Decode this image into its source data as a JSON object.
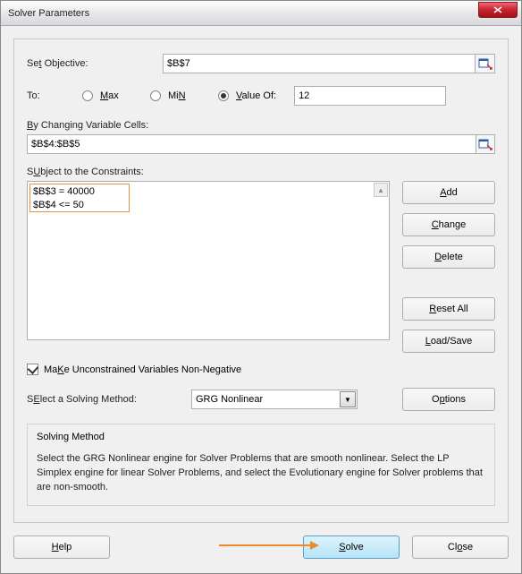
{
  "title": "Solver Parameters",
  "objective": {
    "label": "Set Objective:",
    "hotkey": "t",
    "value": "$B$7"
  },
  "to": {
    "label": "To:",
    "max": "Max",
    "max_hot": "M",
    "min": "Min",
    "min_hot": "N",
    "valueof": "Value Of:",
    "valueof_hot": "V",
    "value": "12"
  },
  "changing": {
    "label": "By Changing Variable Cells:",
    "hot": "B",
    "value": "$B$4:$B$5"
  },
  "constraints": {
    "label": "Subject to the Constraints:",
    "hot": "U",
    "items": [
      "$B$3 = 40000",
      "$B$4 <= 50"
    ]
  },
  "buttons": {
    "add": "Add",
    "add_hot": "A",
    "change": "Change",
    "change_hot": "C",
    "delete": "Delete",
    "delete_hot": "D",
    "reset": "Reset All",
    "reset_hot": "R",
    "loadsave": "Load/Save",
    "loadsave_hot": "L",
    "options": "Options",
    "options_hot": "p",
    "help": "Help",
    "help_hot": "H",
    "solve": "Solve",
    "solve_hot": "S",
    "close": "Close",
    "close_hot": "o"
  },
  "nonneg": {
    "label": "Make Unconstrained Variables Non-Negative",
    "hot": "K",
    "checked": true
  },
  "method": {
    "label": "Select a Solving Method:",
    "hot": "E",
    "value": "GRG Nonlinear"
  },
  "desc": {
    "title": "Solving Method",
    "text": "Select the GRG Nonlinear engine for Solver Problems that are smooth nonlinear. Select the LP Simplex engine for linear Solver Problems, and select the Evolutionary engine for Solver problems that are non-smooth."
  }
}
